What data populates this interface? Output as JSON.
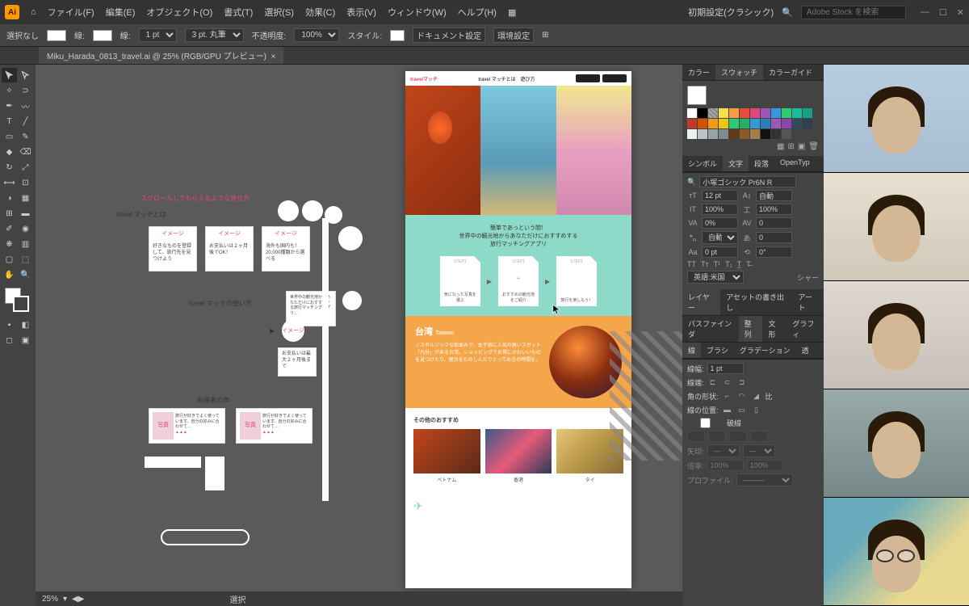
{
  "menubar": {
    "items": [
      "ファイル(F)",
      "編集(E)",
      "オブジェクト(O)",
      "書式(T)",
      "選択(S)",
      "効果(C)",
      "表示(V)",
      "ウィンドウ(W)",
      "ヘルプ(H)"
    ],
    "workspace_preset": "初期設定(クラシック)",
    "search_placeholder": "Adobe Stock を検索"
  },
  "controlbar": {
    "selection": "選択なし",
    "stroke_label": "線:",
    "stroke_weight": "1 pt",
    "brush_label": "線:",
    "brush_preset": "3 pt. 丸筆",
    "opacity_label": "不透明度:",
    "opacity": "100%",
    "style_label": "スタイル:",
    "doc_setup": "ドキュメント設定",
    "prefs": "環境設定"
  },
  "tab": {
    "title": "Miku_Harada_0813_travel.ai @ 25% (RGB/GPU プレビュー)"
  },
  "statusbar": {
    "zoom": "25%",
    "mode": "選択"
  },
  "panels": {
    "color_tabs": [
      "カラー",
      "スウォッチ",
      "カラーガイド"
    ],
    "char_tabs": [
      "シンボル",
      "文字",
      "段落",
      "OpenTyp"
    ],
    "font": "小塚ゴシック Pr6N R",
    "font_size": "12 pt",
    "leading": "自動",
    "tracking": "0",
    "hscale": "100%",
    "vscale": "100%",
    "baseline": "0 pt",
    "lang": "英語:米国",
    "layer_tabs": [
      "レイヤー",
      "アセットの書き出し",
      "アート"
    ],
    "path_tabs": [
      "パスファインダ",
      "整列",
      "文形",
      "グラフィ"
    ],
    "stroke_tabs": [
      "線",
      "ブラシ",
      "グラデーション",
      "透"
    ],
    "stroke_weight_label": "線幅:",
    "stroke_weight": "1 pt",
    "cap_label": "線端:",
    "corner_label": "角の形状:",
    "miter_label": "比",
    "align_label": "線の位置:",
    "dashed": "破線",
    "profile": "プロファイル:"
  },
  "wireframe": {
    "section1_label": "travel マッチとは",
    "box_label": "イメージ",
    "box1_text": "好きなものを登録して、旅行先を見つけよう",
    "box2_text": "お支払いは２ヶ月後でOK！",
    "box3_text": "海外も国内も！20,000種類から選べる",
    "section2_label": "travel マッチの使い方",
    "box4_text": "お支払いは最大２ヶ月後まで",
    "section3_label": "利用者の声",
    "review_label": "写真"
  },
  "design": {
    "logo": "travelマッチ",
    "nav": "travel マッチとは　遊び方",
    "mint_title1": "簡単であっという間！",
    "mint_title2": "世界中の観光地からあなただけにおすすめする",
    "mint_title3": "旅行マッチングアプリ",
    "step_hdr": "STEP1",
    "step1": "気になった写真を選ぶ",
    "step2": "おすすめの観光地をご紹介",
    "step3": "旅行を楽しもう！",
    "taiwan_title": "台湾",
    "taiwan_sub": "Taiwan",
    "taiwan_body": "ノスタルジックな街並みで、女子旅に人気の高いスポット「九份」がある台湾。ショッピングでお得にかわいいものを見つけたり、屋台をたのしんだりとっておきの時間を。",
    "other_title": "その他のおすすめ",
    "thumbs": [
      "ベトナム",
      "香港",
      "タイ"
    ]
  }
}
